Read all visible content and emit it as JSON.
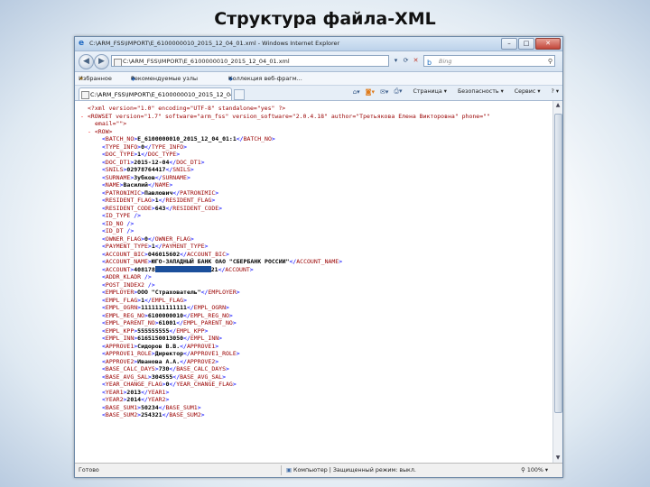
{
  "slide": {
    "title": "Структура файла-XML"
  },
  "window": {
    "title": "C:\\ARM_FSS\\IMPORT\\E_6100000010_2015_12_04_01.xml - Windows Internet Explorer",
    "address": "C:\\ARM_FSS\\IMPORT\\E_6100000010_2015_12_04_01.xml",
    "search_placeholder": "Bing",
    "favorites": {
      "label": "Избранное",
      "item1": "Рекомендуемые узлы",
      "item2": "Коллекция веб-фрагм..."
    },
    "tab_label": "C:\\ARM_FSS\\IMPORT\\E_6100000010_2015_12_04_01.xml",
    "commands": {
      "page": "Страница",
      "safety": "Безопасность",
      "service": "Сервис",
      "help": "?"
    },
    "status": {
      "main": "Готово",
      "zone": "Компьютер | Защищенный режим: выкл.",
      "zoom": "100%"
    }
  },
  "xml_lines": [
    {
      "indent": 0,
      "kind": "pi",
      "text": "<?xml version=\"1.0\" encoding=\"UTF-8\" standalone=\"yes\" ?>"
    },
    {
      "indent": 0,
      "kind": "open",
      "minus": true,
      "text": "<ROWSET version=\"1.7\" software=\"arm_fss\" version_software=\"2.0.4.18\" author=\"Третьякова Елена Викторовна\" phone=\"\""
    },
    {
      "indent": 1,
      "kind": "cont",
      "text": "email=\"\">"
    },
    {
      "indent": 1,
      "kind": "open",
      "minus": true,
      "text": "<ROW>"
    },
    {
      "indent": 2,
      "kind": "el",
      "tag": "BATCH_NO",
      "value": "E_6100000010_2015_12_04_01:1"
    },
    {
      "indent": 2,
      "kind": "el",
      "tag": "TYPE_INFO",
      "value": "0"
    },
    {
      "indent": 2,
      "kind": "el",
      "tag": "DOC_TYPE",
      "value": "1"
    },
    {
      "indent": 2,
      "kind": "el",
      "tag": "DOC_DT1",
      "value": "2015-12-04"
    },
    {
      "indent": 2,
      "kind": "el",
      "tag": "SNILS",
      "value": "02978764417"
    },
    {
      "indent": 2,
      "kind": "el",
      "tag": "SURNAME",
      "value": "Зубков"
    },
    {
      "indent": 2,
      "kind": "el",
      "tag": "NAME",
      "value": "Василий"
    },
    {
      "indent": 2,
      "kind": "el",
      "tag": "PATRONIMIC",
      "value": "Павлович"
    },
    {
      "indent": 2,
      "kind": "el",
      "tag": "RESIDENT_FLAG",
      "value": "1"
    },
    {
      "indent": 2,
      "kind": "el",
      "tag": "RESIDENT_CODE",
      "value": "643"
    },
    {
      "indent": 2,
      "kind": "empty",
      "tag": "ID_TYPE"
    },
    {
      "indent": 2,
      "kind": "empty",
      "tag": "ID_NO"
    },
    {
      "indent": 2,
      "kind": "empty",
      "tag": "ID_DT"
    },
    {
      "indent": 2,
      "kind": "el",
      "tag": "OWNER_FLAG",
      "value": "0"
    },
    {
      "indent": 2,
      "kind": "el",
      "tag": "PAYMENT_TYPE",
      "value": "1"
    },
    {
      "indent": 2,
      "kind": "el",
      "tag": "ACCOUNT_BIC",
      "value": "046015602"
    },
    {
      "indent": 2,
      "kind": "el",
      "tag": "ACCOUNT_NAME",
      "value": "ЮГО-ЗАПАДНЫЙ БАНК ОАО \"СБЕРБАНК РОССИИ\""
    },
    {
      "indent": 2,
      "kind": "redacted",
      "tag": "ACCOUNT",
      "value_start": "408178",
      "value_end": "21"
    },
    {
      "indent": 2,
      "kind": "empty",
      "tag": "ADDR_KLADR"
    },
    {
      "indent": 2,
      "kind": "empty",
      "tag": "POST_INDEX2"
    },
    {
      "indent": 2,
      "kind": "el",
      "tag": "EMPLOYER",
      "value": "ООО \"Страхователь\""
    },
    {
      "indent": 2,
      "kind": "el",
      "tag": "EMPL_FLAG",
      "value": "1"
    },
    {
      "indent": 2,
      "kind": "el",
      "tag": "EMPL_OGRN",
      "value": "1111111111111"
    },
    {
      "indent": 2,
      "kind": "el",
      "tag": "EMPL_REG_NO",
      "value": "6100000010"
    },
    {
      "indent": 2,
      "kind": "el",
      "tag": "EMPL_PARENT_NO",
      "value": "61001"
    },
    {
      "indent": 2,
      "kind": "el",
      "tag": "EMPL_KPP",
      "value": "555555555"
    },
    {
      "indent": 2,
      "kind": "el",
      "tag": "EMPL_INN",
      "value": "6165150013050"
    },
    {
      "indent": 2,
      "kind": "el",
      "tag": "APPROVE1",
      "value": "Сидоров В.В."
    },
    {
      "indent": 2,
      "kind": "el",
      "tag": "APPROVE1_ROLE",
      "value": "Директор"
    },
    {
      "indent": 2,
      "kind": "el",
      "tag": "APPROVE2",
      "value": "Иванова А.А."
    },
    {
      "indent": 2,
      "kind": "el",
      "tag": "BASE_CALC_DAYS",
      "value": "730"
    },
    {
      "indent": 2,
      "kind": "el",
      "tag": "BASE_AVG_SAL",
      "value": "304555"
    },
    {
      "indent": 2,
      "kind": "el",
      "tag": "YEAR_CHANGE_FLAG",
      "value": "0"
    },
    {
      "indent": 2,
      "kind": "el",
      "tag": "YEAR1",
      "value": "2013"
    },
    {
      "indent": 2,
      "kind": "el",
      "tag": "YEAR2",
      "value": "2014"
    },
    {
      "indent": 2,
      "kind": "el",
      "tag": "BASE_SUM1",
      "value": "50234"
    },
    {
      "indent": 2,
      "kind": "el",
      "tag": "BASE_SUM2",
      "value": "254321"
    }
  ]
}
